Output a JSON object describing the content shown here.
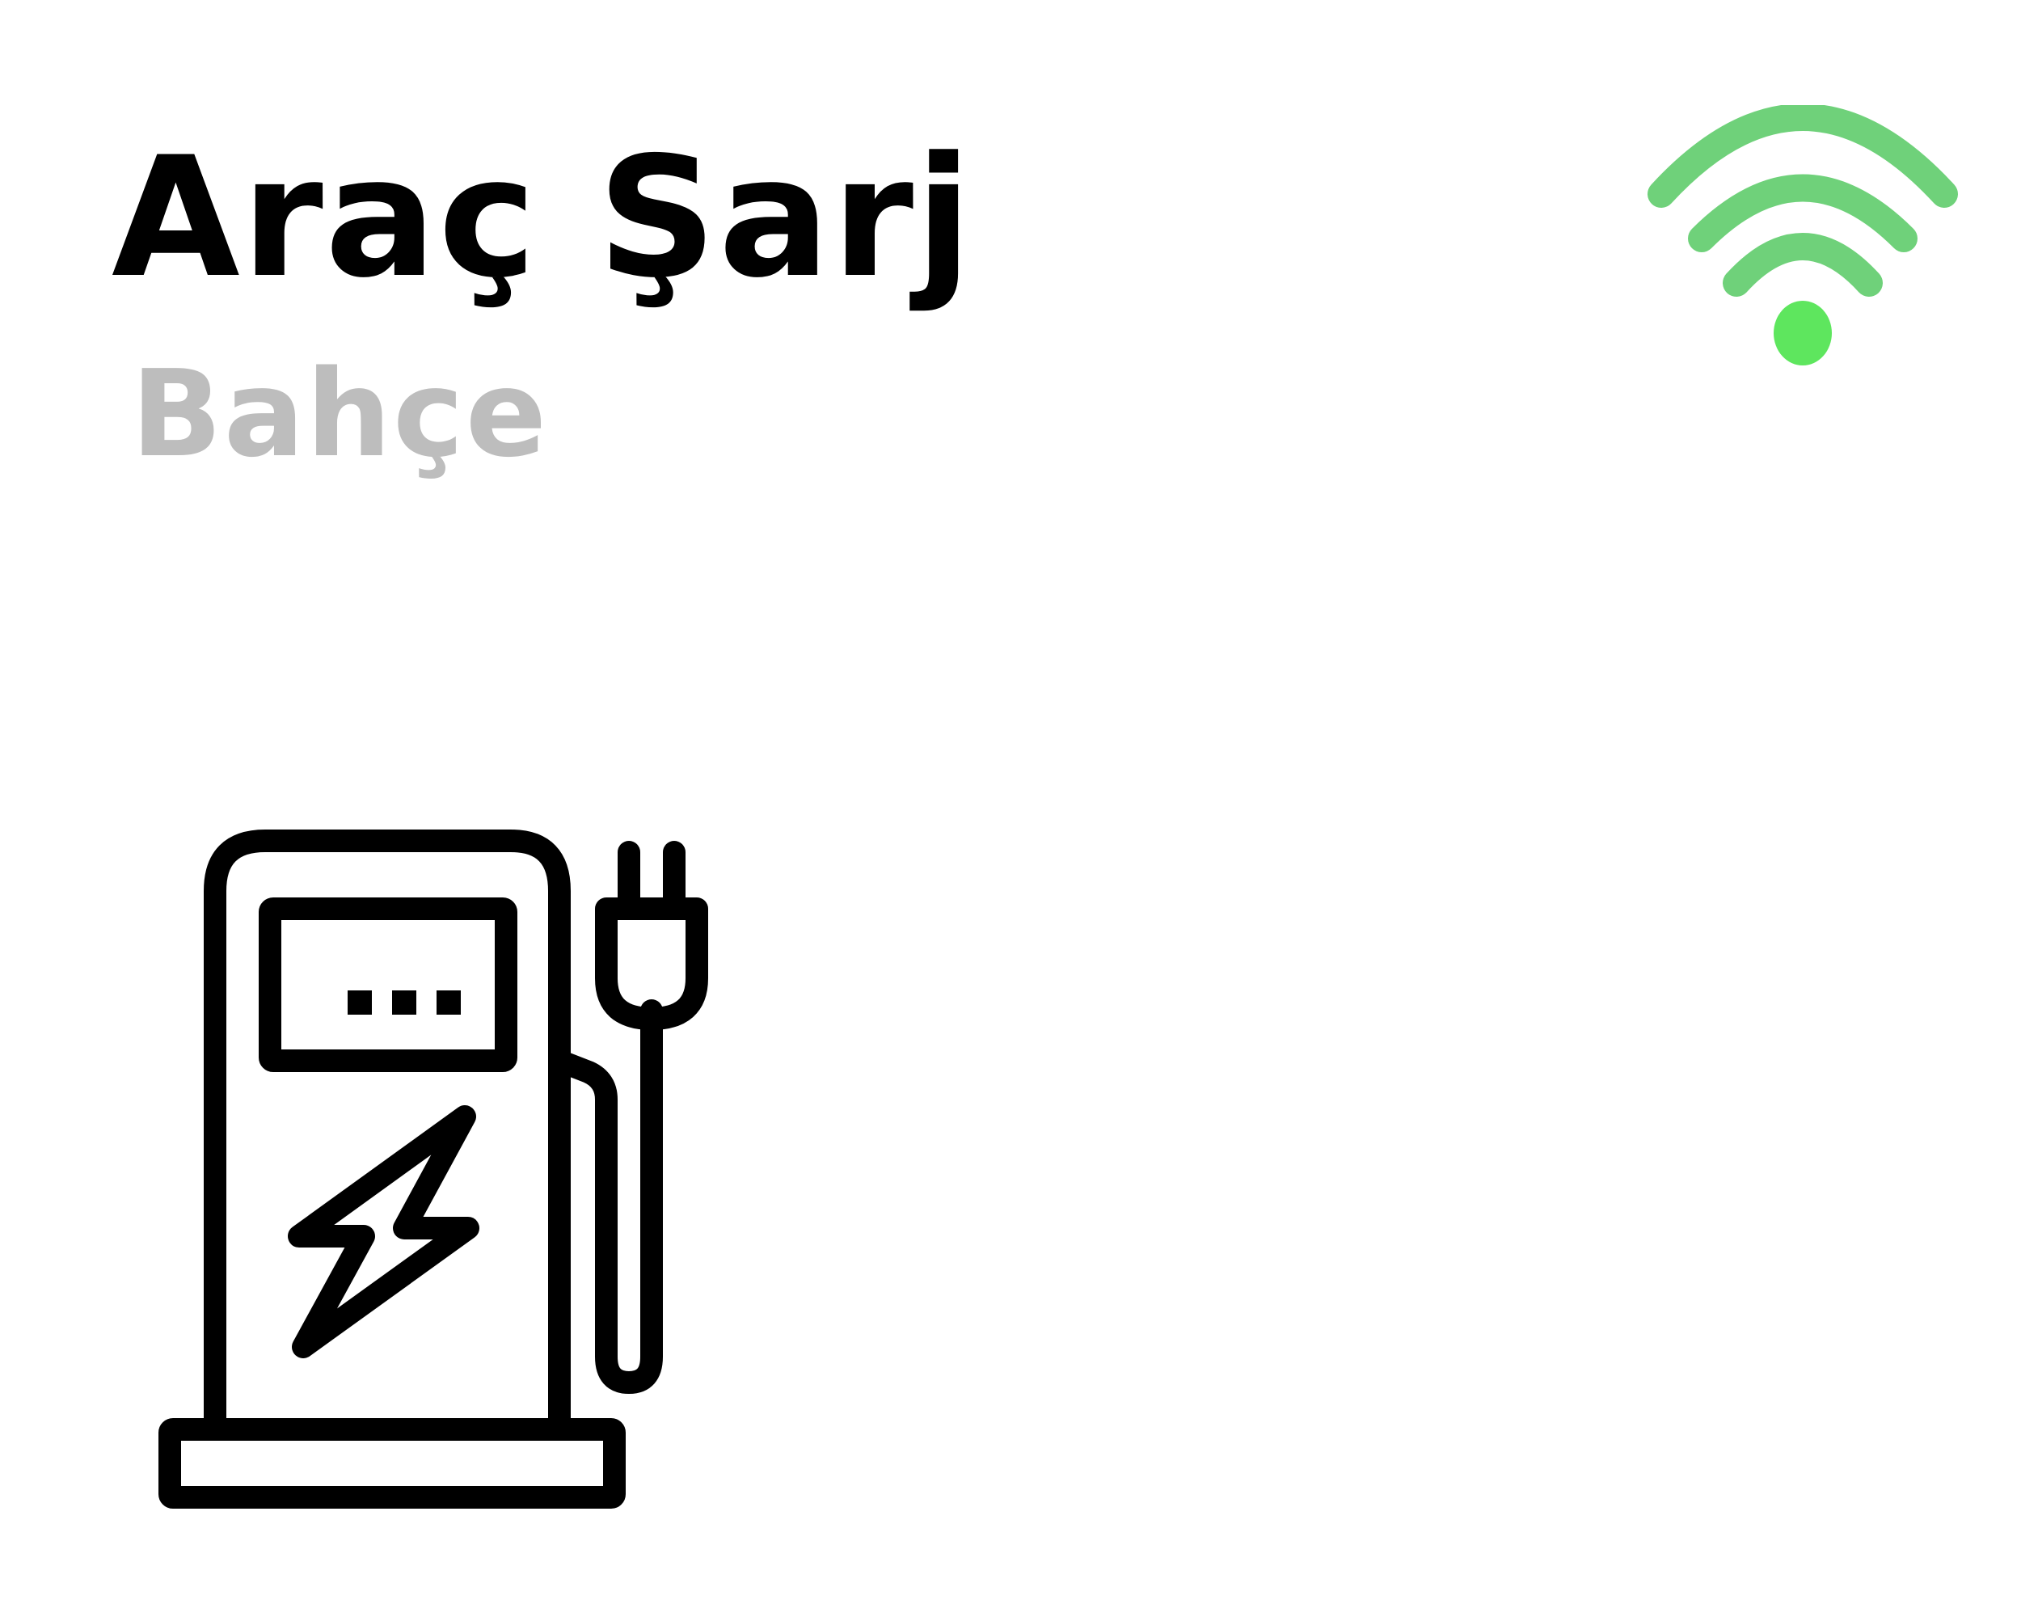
{
  "tile": {
    "title": "Araç Şarj",
    "subtitle": "Bahçe"
  },
  "status": {
    "icon": "wifi-icon",
    "connected": true,
    "signal_bars": 3
  },
  "device": {
    "icon": "ev-charger-icon",
    "display_text": "..."
  },
  "colors": {
    "title": "#000000",
    "subtitle": "#bdbdbd",
    "wifi_arcs": "#6fd17a",
    "wifi_dot": "#5ee65e",
    "icon_stroke": "#000000",
    "background": "#ffffff"
  }
}
